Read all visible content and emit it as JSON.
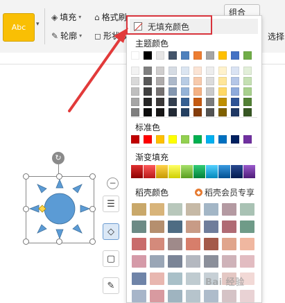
{
  "ribbon": {
    "style_thumb_label": "Abc",
    "fill_label": "填充",
    "format_painter_label": "格式刷",
    "outline_label": "轮廓",
    "shape_effect_label": "形状效",
    "select_partial": "选择",
    "combine_partial": "组合"
  },
  "popup": {
    "no_fill_label": "无填充颜色",
    "theme_colors_label": "主题颜色",
    "standard_colors_label": "标准色",
    "gradient_fill_label": "渐变填充",
    "docer_colors_label": "稻壳颜色",
    "docer_vip_label": "稻壳会员专享",
    "theme_top_row": [
      "#ffffff",
      "#000000",
      "#e7e6e6",
      "#44546a",
      "#4f81bd",
      "#ed7d31",
      "#a5a5a5",
      "#ffc000",
      "#4472c4",
      "#70ad47"
    ],
    "theme_shades": [
      [
        "#f2f2f2",
        "#808080",
        "#d0cece",
        "#d6dce4",
        "#dbe5f1",
        "#fbe4d5",
        "#ededed",
        "#fff2cc",
        "#dae3f3",
        "#e2efd9"
      ],
      [
        "#d9d9d9",
        "#595959",
        "#aeabab",
        "#adb9ca",
        "#b8cce4",
        "#f7caac",
        "#dbdbdb",
        "#ffe699",
        "#b4c6e7",
        "#c5e0b3"
      ],
      [
        "#bfbfbf",
        "#404040",
        "#757171",
        "#8497b0",
        "#95b3d7",
        "#f4b183",
        "#c9c9c9",
        "#ffd966",
        "#8eaadb",
        "#a8d08d"
      ],
      [
        "#a6a6a6",
        "#262626",
        "#3a3838",
        "#333f4f",
        "#366092",
        "#c55a11",
        "#7b7b7b",
        "#bf8f00",
        "#2f5496",
        "#538135"
      ],
      [
        "#7f7f7f",
        "#0d0d0d",
        "#171616",
        "#222a35",
        "#244061",
        "#843c0b",
        "#525252",
        "#7f6000",
        "#1f3864",
        "#375623"
      ]
    ],
    "standard_colors": [
      "#c00000",
      "#ff0000",
      "#ffc000",
      "#ffff00",
      "#92d050",
      "#00b050",
      "#00b0f0",
      "#0070c0",
      "#002060",
      "#7030a0"
    ],
    "gradient_colors": [
      [
        "#8e0000",
        "#e03030"
      ],
      [
        "#b81818",
        "#ff5a5a"
      ],
      [
        "#c79a00",
        "#ffd24a"
      ],
      [
        "#cfcf00",
        "#ffff66"
      ],
      [
        "#5a9e1e",
        "#a6e06a"
      ],
      [
        "#00803a",
        "#33cc77"
      ],
      [
        "#0088bb",
        "#55d0ff"
      ],
      [
        "#004f91",
        "#3a9ae0"
      ],
      [
        "#001a50",
        "#2a4a90"
      ],
      [
        "#4e1c78",
        "#9a5acc"
      ]
    ],
    "docer_colors": [
      [
        "#c9a86a",
        "#d8b47a",
        "#b8c7bb",
        "#c6b9a6",
        "#a3b6c6",
        "#b49aa2",
        "#a9c2b4"
      ],
      [
        "#6c8a85",
        "#b58f6e",
        "#4e6c83",
        "#c89b86",
        "#6f7d9b",
        "#b06b74",
        "#6f9b88"
      ],
      [
        "#c96c6c",
        "#d48a7b",
        "#9f8a8a",
        "#d77e6b",
        "#a45a4a",
        "#e0a58c",
        "#f0b7a0"
      ],
      [
        "#d59aa8",
        "#9aa6b6",
        "#7b8597",
        "#b4b8c0",
        "#8b8f9a",
        "#cfb3b9",
        "#e2bcc1"
      ],
      [
        "#6f84a8",
        "#e8b7b0",
        "#a9c0c8",
        "#bfcbd0",
        "#c7d0d6",
        "#e4c8c4",
        "#f2d9d6"
      ],
      [
        "#a7b5c9",
        "#d89aa0",
        "#9fb4c0",
        "#b6c4cc",
        "#aebccb",
        "#d5c3c6",
        "#e9d2d4"
      ]
    ]
  },
  "watermark": "Bai 经验"
}
